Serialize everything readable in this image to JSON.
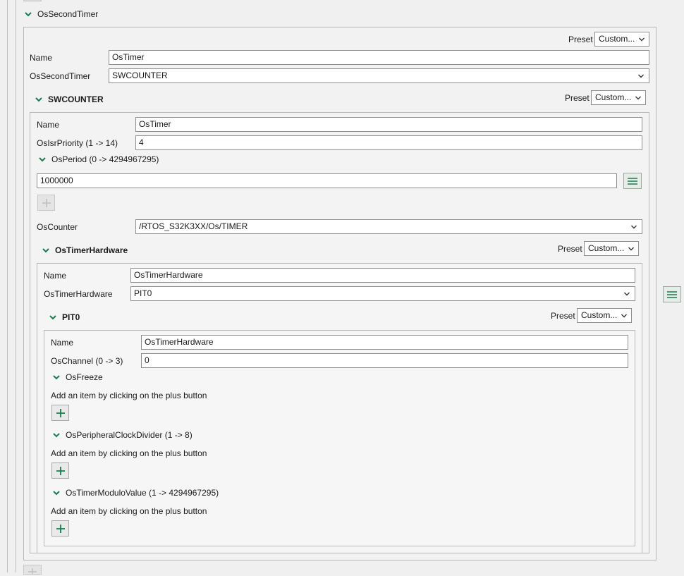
{
  "colors": {
    "accent": "#1b7a4f",
    "border": "#b8b8b8",
    "field_border": "#8e8e8e"
  },
  "icons": {
    "chevron": "chevron-down-icon",
    "plus": "plus-icon",
    "menu": "hamburger-menu-icon",
    "dropdown": "dropdown-arrow-icon"
  },
  "preset_label": "Preset",
  "preset_value": "Custom...",
  "add_hint": "Add an item by clicking on the plus button",
  "sections": {
    "second_timer": {
      "title": "OsSecondTimer"
    },
    "swcounter": {
      "title": "SWCOUNTER"
    },
    "os_period": {
      "title": "OsPeriod (0 -> 4294967295)"
    },
    "timer_hardware": {
      "title": "OsTimerHardware"
    },
    "pit0": {
      "title": "PIT0"
    },
    "freeze": {
      "title": "OsFreeze"
    },
    "clock_divider": {
      "title": "OsPeripheralClockDivider (1 -> 8)"
    },
    "modulo_value": {
      "title": "OsTimerModuloValue (1 -> 4294967295)"
    }
  },
  "fields": {
    "l1_name": {
      "label": "Name",
      "value": "OsTimer"
    },
    "l1_second_timer": {
      "label": "OsSecondTimer",
      "value": "SWCOUNTER"
    },
    "l2_name": {
      "label": "Name",
      "value": "OsTimer"
    },
    "l2_isr_priority": {
      "label": "OsIsrPriority (1 -> 14)",
      "value": "4"
    },
    "l2_period_value": {
      "value": "1000000"
    },
    "l2_counter": {
      "label": "OsCounter",
      "value": "/RTOS_S32K3XX/Os/TIMER"
    },
    "l3_name": {
      "label": "Name",
      "value": "OsTimerHardware"
    },
    "l3_timer_hardware": {
      "label": "OsTimerHardware",
      "value": "PIT0"
    },
    "l4_name": {
      "label": "Name",
      "value": "OsTimerHardware"
    },
    "l4_channel": {
      "label": "OsChannel (0 -> 3)",
      "value": "0"
    }
  }
}
